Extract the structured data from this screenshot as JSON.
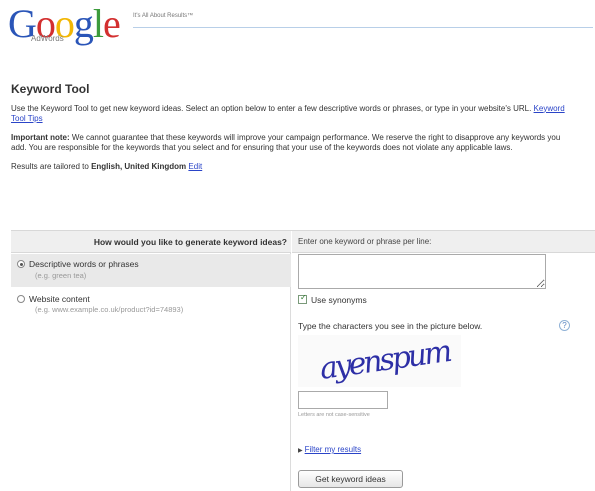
{
  "header": {
    "logo_letters": [
      "G",
      "o",
      "o",
      "g",
      "l",
      "e"
    ],
    "logo_sub": "AdWords",
    "tagline": "It's All About Results™"
  },
  "page": {
    "title": "Keyword Tool",
    "intro_text": "Use the Keyword Tool to get new keyword ideas. Select an option below to enter a few descriptive words or phrases, or type in your website's URL.",
    "intro_link": "Keyword Tool Tips",
    "note_label": "Important note:",
    "note_text": "We cannot guarantee that these keywords will improve your campaign performance. We reserve the right to disapprove any keywords you add. You are responsible for the keywords that you select and for ensuring that your use of the keywords does not violate any applicable laws.",
    "results_prefix": "Results are tailored to",
    "results_locale": "English, United Kingdom",
    "results_edit": "Edit"
  },
  "generate": {
    "heading": "How would you like to generate keyword ideas?",
    "options": [
      {
        "label": "Descriptive words or phrases",
        "example": "(e.g. green tea)",
        "selected": true
      },
      {
        "label": "Website content",
        "example": "(e.g. www.example.co.uk/product?id=74893)",
        "selected": false
      }
    ]
  },
  "entry": {
    "heading": "Enter one keyword or phrase per line:",
    "keywords_value": "",
    "use_synonyms_label": "Use synonyms",
    "use_synonyms_checked": true,
    "captcha_label": "Type the characters you see in the picture below.",
    "captcha_text": "ayenspum",
    "captcha_answer": "",
    "case_note": "Letters are not case-sensitive",
    "filter_link": "Filter my results",
    "submit_label": "Get keyword ideas"
  },
  "colors": {
    "link": "#2a44c8",
    "logo_blue": "#2a55b8",
    "logo_red": "#d32f2f",
    "logo_yellow": "#f2b705",
    "logo_green": "#3c9b3c",
    "panel_header": "#efefef",
    "selected_option": "#e9e9e9"
  },
  "icons": [
    "radio-selected-icon",
    "radio-unselected-icon",
    "checkbox-checked-icon",
    "help-icon",
    "triangle-right-icon"
  ]
}
